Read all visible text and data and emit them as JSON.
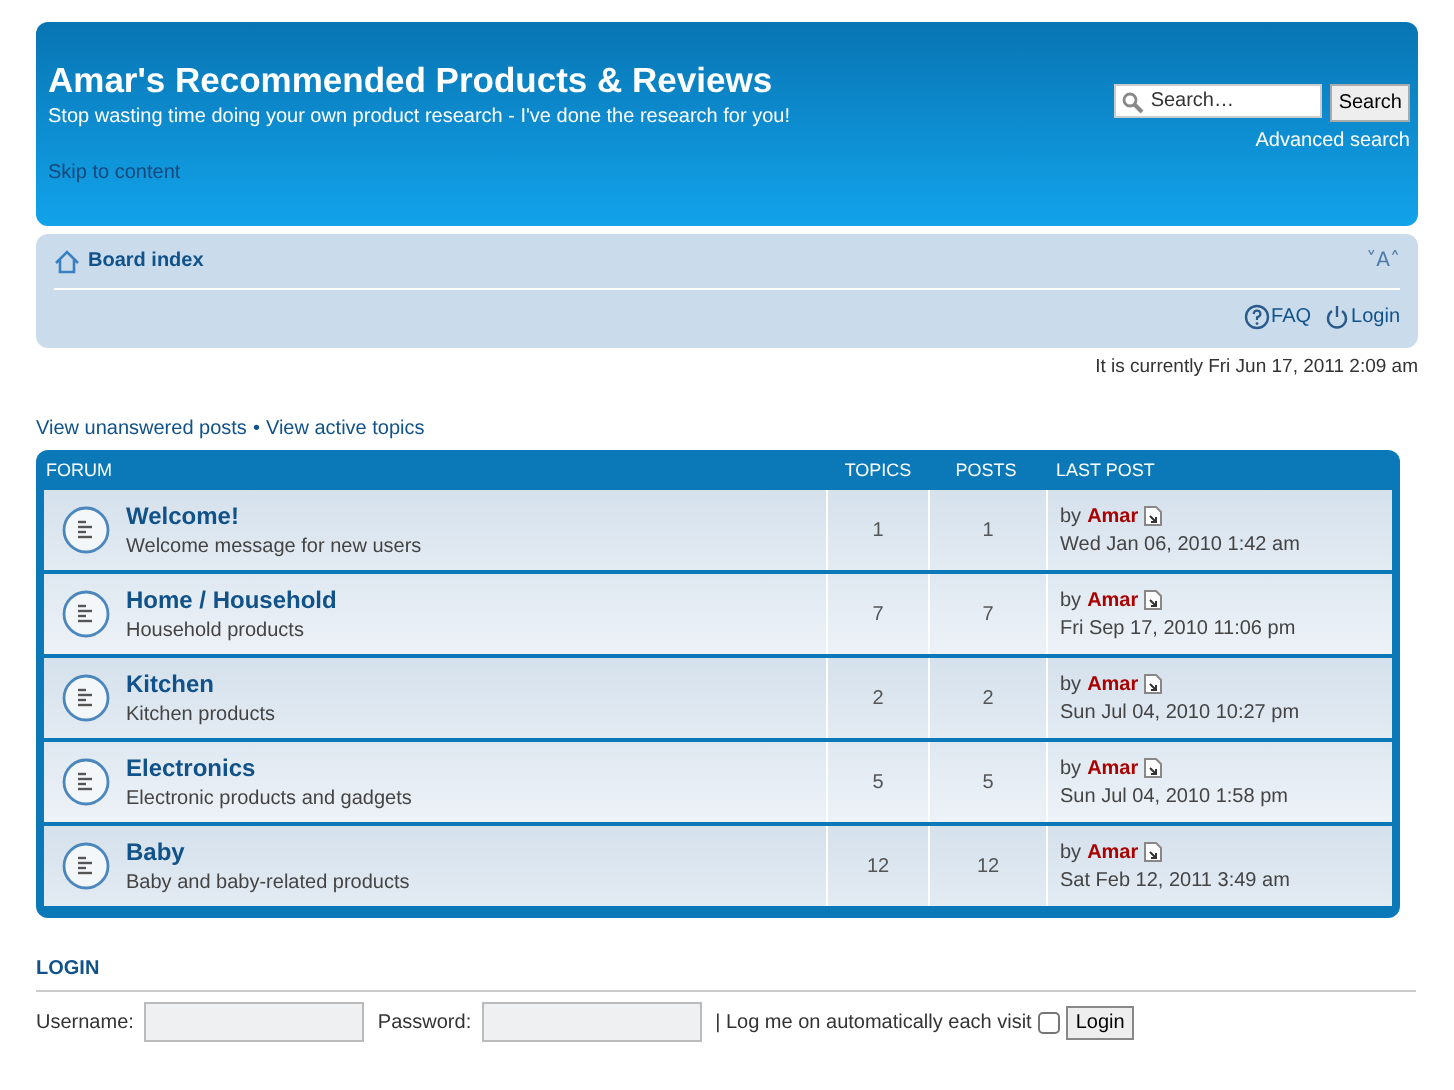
{
  "header": {
    "title": "Amar's Recommended Products & Reviews",
    "tagline": "Stop wasting time doing your own product research - I've done the research for you!",
    "skip_link": "Skip to content",
    "search": {
      "placeholder": "Search…",
      "button": "Search",
      "advanced": "Advanced search"
    }
  },
  "navbar": {
    "board_index": "Board index",
    "font_toggle": "˅A˄",
    "links": [
      {
        "kind": "faq",
        "label": "FAQ"
      },
      {
        "kind": "login",
        "label": "Login"
      }
    ]
  },
  "current_time": "It is currently Fri Jun 17, 2011 2:09 am",
  "quick_links": [
    "View unanswered posts",
    "View active topics"
  ],
  "quick_links_separator": "•",
  "forum_table": {
    "columns": [
      "FORUM",
      "TOPICS",
      "POSTS",
      "LAST POST"
    ],
    "rows": [
      {
        "name": "Welcome!",
        "description": "Welcome message for new users",
        "topics": "1",
        "posts": "1",
        "by": "by",
        "author": "Amar",
        "date": "Wed Jan 06, 2010 1:42 am"
      },
      {
        "name": "Home / Household",
        "description": "Household products",
        "topics": "7",
        "posts": "7",
        "by": "by",
        "author": "Amar",
        "date": "Fri Sep 17, 2010 11:06 pm"
      },
      {
        "name": "Kitchen",
        "description": "Kitchen products",
        "topics": "2",
        "posts": "2",
        "by": "by",
        "author": "Amar",
        "date": "Sun Jul 04, 2010 10:27 pm"
      },
      {
        "name": "Electronics",
        "description": "Electronic products and gadgets",
        "topics": "5",
        "posts": "5",
        "by": "by",
        "author": "Amar",
        "date": "Sun Jul 04, 2010 1:58 pm"
      },
      {
        "name": "Baby",
        "description": "Baby and baby-related products",
        "topics": "12",
        "posts": "12",
        "by": "by",
        "author": "Amar",
        "date": "Sat Feb 12, 2011 3:49 am"
      }
    ]
  },
  "login": {
    "heading": "LOGIN",
    "username_label": "Username:",
    "password_label": "Password:",
    "remember_label": "| Log me on automatically each visit",
    "remember_checked": false,
    "button": "Login"
  }
}
